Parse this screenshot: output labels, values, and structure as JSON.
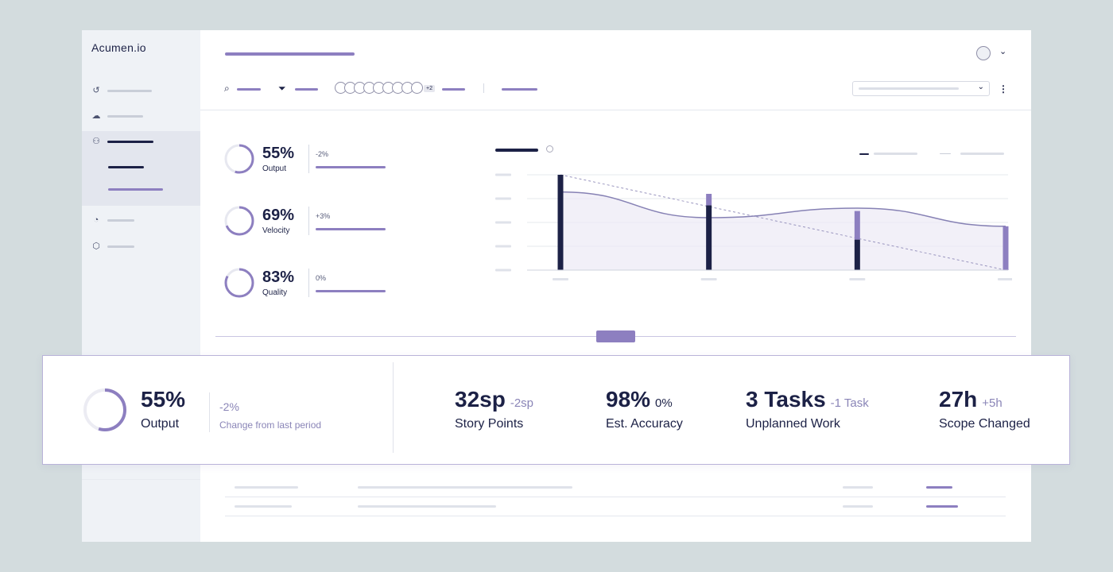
{
  "brand": {
    "logo_text": "Acumen.io"
  },
  "sidebar": {
    "items": [
      {
        "icon": "history-icon"
      },
      {
        "icon": "team-icon"
      },
      {
        "icon": "user-icon",
        "active": true
      },
      {
        "icon": "pie-chart-icon"
      },
      {
        "icon": "settings-icon"
      }
    ]
  },
  "toolbar": {
    "search_icon": "search-icon",
    "filter_icon": "filter-icon",
    "avatar_extra": "+2",
    "more_icon": "⋮",
    "dropdown_icon": "chevron-down-icon"
  },
  "metrics": [
    {
      "percent": "55%",
      "label": "Output",
      "delta": "-2%",
      "fraction": 0.55
    },
    {
      "percent": "69%",
      "label": "Velocity",
      "delta": "+3%",
      "fraction": 0.69
    },
    {
      "percent": "83%",
      "label": "Quality",
      "delta": "0%",
      "fraction": 0.83
    }
  ],
  "chart_data": {
    "type": "bar",
    "categories": [
      "",
      "",
      "",
      ""
    ],
    "series": [
      {
        "values": [
          100,
          68,
          32,
          0
        ]
      },
      {
        "values": [
          0,
          12,
          30,
          46
        ]
      }
    ],
    "trend_line": [
      82,
      55,
      65,
      46
    ],
    "ylim": [
      0,
      100
    ],
    "grid": true,
    "colors": {
      "dark": "#1c2146",
      "accent": "#8d7fc0",
      "line": "#8681b4"
    }
  },
  "summary_card": {
    "output_percent": "55%",
    "output_label": "Output",
    "output_fraction": 0.55,
    "output_delta": "-2%",
    "output_delta_note": "Change from last period",
    "stats": [
      {
        "value": "32sp",
        "delta": "-2sp",
        "label": "Story Points"
      },
      {
        "value": "98%",
        "delta": "0%",
        "label": "Est. Accuracy"
      },
      {
        "value": "3 Tasks",
        "delta": "-1 Task",
        "label": "Unplanned Work"
      },
      {
        "value": "27h",
        "delta": "+5h",
        "label": "Scope Changed"
      }
    ]
  },
  "colors": {
    "primary": "#1c2146",
    "accent": "#8d7fc0",
    "background": "#d3dcde"
  }
}
